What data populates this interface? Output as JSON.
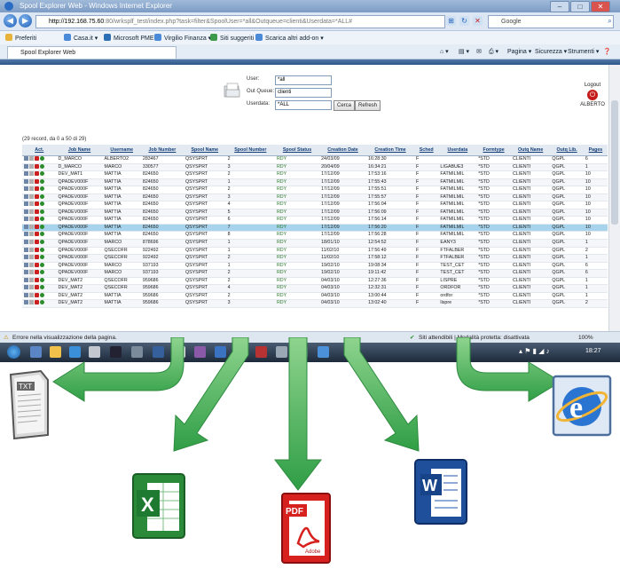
{
  "window": {
    "title": "Spool Explorer Web - Windows Internet Explorer",
    "url_host": "http://192.168.75.60",
    "url_path": ":80/wrksplf_test/index.php?task=filter&SpoolUser=*all&Outqueue=clienti&Userdata=*ALL#",
    "search_placeholder": "Google"
  },
  "favorites": {
    "label": "Preferiti",
    "items": [
      "Casa.it ▾",
      "Microsoft PME ▾",
      "Virgilio Finanza ▾",
      "Siti suggeriti ▾",
      "Scarica altri add-on ▾"
    ]
  },
  "tab": {
    "title": "Spool Explorer Web"
  },
  "tools": [
    "Pagina ▾",
    "Sicurezza ▾",
    "Strumenti ▾"
  ],
  "filter": {
    "user_label": "User:",
    "user_value": "*all",
    "outqueue_label": "Out Queue:",
    "outqueue_value": "clienti",
    "userdata_label": "Userdata:",
    "userdata_value": "*ALL",
    "search_button": "Cerca",
    "refresh_button": "Refresh"
  },
  "logout": {
    "label": "Logout",
    "user": "ALBERTO"
  },
  "records_text": "(29 record, da 0 a 50 di 29)",
  "grid": {
    "columns": [
      "Act.",
      "Job Name",
      "Username",
      "Job Number",
      "Spool Name",
      "Spool Number",
      "Spool Status",
      "Creation Date",
      "Creation Time",
      "Sched",
      "Userdata",
      "Formtype",
      "Outq Name",
      "Outq Lib.",
      "Pages"
    ],
    "selected_row": 9,
    "rows": [
      [
        "D_MARCO",
        "ALBERTO2",
        "283467",
        "QSYSPRT",
        "2",
        "RDY",
        "24/03/09",
        "16:28:30",
        "F",
        "",
        "*STD",
        "CLIENTI",
        "QGPL",
        "6"
      ],
      [
        "D_MARCO",
        "MARCO",
        "330577",
        "QSYSPRT",
        "3",
        "RDY",
        "20/04/09",
        "16:34:21",
        "F",
        "LIGABUE3",
        "*STD",
        "CLIENTI",
        "QGPL",
        "1"
      ],
      [
        "DEV_MAT1",
        "MATTIA",
        "824650",
        "QSYSPRT",
        "2",
        "RDY",
        "17/12/09",
        "17:53:16",
        "F",
        "FATMILMIL",
        "*STD",
        "CLIENTI",
        "QGPL",
        "10"
      ],
      [
        "QPADEV000F",
        "MATTIA",
        "824650",
        "QSYSPRT",
        "1",
        "RDY",
        "17/12/09",
        "17:55:43",
        "F",
        "FATMILMIL",
        "*STD",
        "CLIENTI",
        "QGPL",
        "10"
      ],
      [
        "QPADEV000F",
        "MATTIA",
        "824650",
        "QSYSPRT",
        "2",
        "RDY",
        "17/12/09",
        "17:55:51",
        "F",
        "FATMILMIL",
        "*STD",
        "CLIENTI",
        "QGPL",
        "10"
      ],
      [
        "QPADEV000F",
        "MATTIA",
        "824650",
        "QSYSPRT",
        "3",
        "RDY",
        "17/12/09",
        "17:55:57",
        "F",
        "FATMILMIL",
        "*STD",
        "CLIENTI",
        "QGPL",
        "10"
      ],
      [
        "QPADEV000F",
        "MATTIA",
        "824650",
        "QSYSPRT",
        "4",
        "RDY",
        "17/12/09",
        "17:56:04",
        "F",
        "FATMILMIL",
        "*STD",
        "CLIENTI",
        "QGPL",
        "10"
      ],
      [
        "QPADEV000F",
        "MATTIA",
        "824650",
        "QSYSPRT",
        "5",
        "RDY",
        "17/12/09",
        "17:56:09",
        "F",
        "FATMILMIL",
        "*STD",
        "CLIENTI",
        "QGPL",
        "10"
      ],
      [
        "QPADEV000F",
        "MATTIA",
        "824650",
        "QSYSPRT",
        "6",
        "RDY",
        "17/12/09",
        "17:56:14",
        "F",
        "FATMILMIL",
        "*STD",
        "CLIENTI",
        "QGPL",
        "10"
      ],
      [
        "QPADEV000F",
        "MATTIA",
        "824650",
        "QSYSPRT",
        "7",
        "RDY",
        "17/12/09",
        "17:56:20",
        "F",
        "FATMILMIL",
        "*STD",
        "CLIENTI",
        "QGPL",
        "10"
      ],
      [
        "QPADEV000F",
        "MATTIA",
        "824650",
        "QSYSPRT",
        "8",
        "RDY",
        "17/12/09",
        "17:56:28",
        "F",
        "FATMILMIL",
        "*STD",
        "CLIENTI",
        "QGPL",
        "10"
      ],
      [
        "QPADEV000F",
        "MARCO",
        "878696",
        "QSYSPRT",
        "1",
        "RDY",
        "18/01/10",
        "12:54:52",
        "F",
        "EANY3",
        "*STD",
        "CLIENTI",
        "QGPL",
        "1"
      ],
      [
        "QPADEV000F",
        "QSECOFR",
        "922492",
        "QSYSPRT",
        "1",
        "RDY",
        "11/02/10",
        "17:56:49",
        "F",
        "FTFALBER",
        "*STD",
        "CLIENTI",
        "QGPL",
        "2"
      ],
      [
        "QPADEV000F",
        "QSECOFR",
        "922492",
        "QSYSPRT",
        "2",
        "RDY",
        "11/02/10",
        "17:58:12",
        "F",
        "FTFALBER",
        "*STD",
        "CLIENTI",
        "QGPL",
        "1"
      ],
      [
        "QPADEV000F",
        "MARCO",
        "937193",
        "QSYSPRT",
        "1",
        "RDY",
        "19/02/10",
        "19:08:34",
        "F",
        "TEST_CET",
        "*STD",
        "CLIENTI",
        "QGPL",
        "6"
      ],
      [
        "QPADEV000F",
        "MARCO",
        "937193",
        "QSYSPRT",
        "2",
        "RDY",
        "19/02/10",
        "19:11:42",
        "F",
        "TEST_CET",
        "*STD",
        "CLIENTI",
        "QGPL",
        "6"
      ],
      [
        "DEV_MAT2",
        "QSECOFR",
        "959686",
        "QSYSPRT",
        "2",
        "RDY",
        "04/03/10",
        "12:27:36",
        "F",
        "LISPRE",
        "*STD",
        "CLIENTI",
        "QGPL",
        "1"
      ],
      [
        "DEV_MAT2",
        "QSECOFR",
        "959686",
        "QSYSPRT",
        "4",
        "RDY",
        "04/03/10",
        "12:32:31",
        "F",
        "ORDFOR",
        "*STD",
        "CLIENTI",
        "QGPL",
        "1"
      ],
      [
        "DEV_MAT2",
        "MATTIA",
        "959686",
        "QSYSPRT",
        "2",
        "RDY",
        "04/03/10",
        "13:00:44",
        "F",
        "ordfor",
        "*STD",
        "CLIENTI",
        "QGPL",
        "1"
      ],
      [
        "DEV_MAT2",
        "MATTIA",
        "959686",
        "QSYSPRT",
        "3",
        "RDY",
        "04/03/10",
        "13:02:40",
        "F",
        "lispre",
        "*STD",
        "CLIENTI",
        "QGPL",
        "2"
      ]
    ]
  },
  "status": {
    "error_text": "Errore nella visualizzazione della pagina.",
    "security_text": "Siti attendibili | Modalità protetta: disattivata",
    "zoom": "100%"
  },
  "taskbar": {
    "clock": "18:27"
  },
  "exports": {
    "txt_label": "TXT",
    "xls_label": "X",
    "pdf_label": "PDF",
    "pdf_sub": "Adobe",
    "doc_label": "W",
    "ie_label": "e"
  },
  "colors": {
    "arrow": "#3fae53",
    "selected_row": "#a7d4ec",
    "status_green": "#2c7a2c"
  }
}
